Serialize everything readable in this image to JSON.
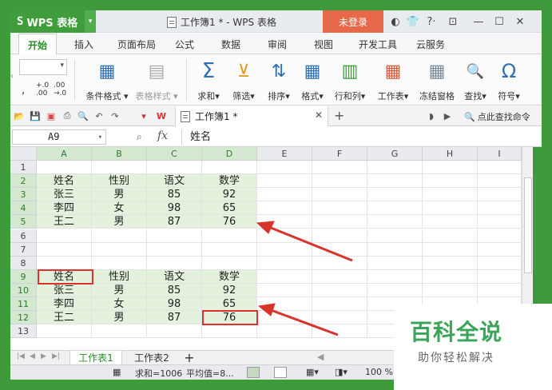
{
  "titlebar": {
    "app_name": "WPS 表格",
    "logo": "S",
    "doc_title": "工作簿1 * - WPS 表格",
    "login_label": "未登录",
    "controls": [
      "minimize",
      "maximize",
      "close"
    ]
  },
  "menu_tabs": [
    "开始",
    "插入",
    "页面布局",
    "公式",
    "数据",
    "审阅",
    "视图",
    "开发工具",
    "云服务"
  ],
  "active_tab": "开始",
  "ribbon": {
    "buttons": [
      {
        "label": "条件格式",
        "icon": "conditional-format-icon",
        "glyph": "▦"
      },
      {
        "label": "表格样式",
        "icon": "table-style-icon",
        "glyph": "▤"
      },
      {
        "label": "求和",
        "icon": "sum-icon",
        "glyph": "Σ"
      },
      {
        "label": "筛选",
        "icon": "filter-icon",
        "glyph": "⊻"
      },
      {
        "label": "排序",
        "icon": "sort-icon",
        "glyph": "⇅"
      },
      {
        "label": "格式",
        "icon": "format-icon",
        "glyph": "▦"
      },
      {
        "label": "行和列",
        "icon": "rows-columns-icon",
        "glyph": "▥"
      },
      {
        "label": "工作表",
        "icon": "worksheet-icon",
        "glyph": "▦"
      },
      {
        "label": "冻结窗格",
        "icon": "freeze-panes-icon",
        "glyph": "▦"
      },
      {
        "label": "查找",
        "icon": "find-icon",
        "glyph": "🔍"
      },
      {
        "label": "符号",
        "icon": "symbol-icon",
        "glyph": "Ω"
      }
    ],
    "decimal_labels": [
      ",",
      "+.0",
      ".00",
      ".00",
      "→.0"
    ]
  },
  "quickbar": {
    "doc_tab": "工作簿1 *",
    "search_cmd": "点此查找命令"
  },
  "formula_bar": {
    "cell_ref": "A9",
    "fx": "fx",
    "value": "姓名"
  },
  "grid": {
    "columns": [
      "A",
      "B",
      "C",
      "D",
      "E",
      "F",
      "G",
      "H",
      "I"
    ],
    "rows": [
      "1",
      "2",
      "3",
      "4",
      "5",
      "6",
      "7",
      "8",
      "9",
      "10",
      "11",
      "12",
      "13"
    ],
    "table1": [
      [
        "姓名",
        "性别",
        "语文",
        "数学"
      ],
      [
        "张三",
        "男",
        "85",
        "92"
      ],
      [
        "李四",
        "女",
        "98",
        "65"
      ],
      [
        "王二",
        "男",
        "87",
        "76"
      ]
    ],
    "table2": [
      [
        "姓名",
        "性别",
        "语文",
        "数学"
      ],
      [
        "张三",
        "男",
        "85",
        "92"
      ],
      [
        "李四",
        "女",
        "98",
        "65"
      ],
      [
        "王二",
        "男",
        "87",
        "76"
      ]
    ]
  },
  "sheet_tabs": [
    "工作表1",
    "工作表2"
  ],
  "add_sheet": "+",
  "statusbar": {
    "sum": "求和=1006",
    "avg": "平均值=8...",
    "zoom": "100 %"
  },
  "watermark": {
    "title": "百科全说",
    "subtitle": "助你轻松解决"
  },
  "colors": {
    "brand": "#3f9d3c",
    "login": "#e8694a",
    "highlight": "#d9342b",
    "table_fill": "#e3f1dd"
  }
}
